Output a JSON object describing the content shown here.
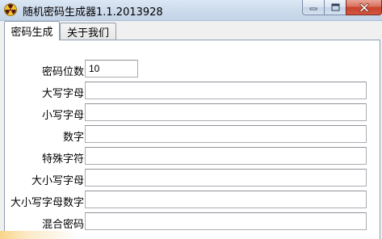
{
  "window": {
    "title": "随机密码生成器1.1.2013928",
    "icon": "radiation-icon"
  },
  "tabs": [
    {
      "label": "密码生成",
      "active": true
    },
    {
      "label": "关于我们",
      "active": false
    }
  ],
  "form": {
    "length": {
      "label": "密码位数",
      "value": "10"
    },
    "uppercase": {
      "label": "大写字母",
      "value": ""
    },
    "lowercase": {
      "label": "小写字母",
      "value": ""
    },
    "digits": {
      "label": "数字",
      "value": ""
    },
    "special": {
      "label": "特殊字符",
      "value": ""
    },
    "mixed_case": {
      "label": "大小写字母",
      "value": ""
    },
    "mixed_case_digits": {
      "label": "大小写字母数字",
      "value": ""
    },
    "mixed": {
      "label": "混合密码",
      "value": ""
    }
  },
  "colors": {
    "titlebar": "#cfdcec",
    "close_button": "#c7432c",
    "panel_border": "#8e9fb3"
  }
}
